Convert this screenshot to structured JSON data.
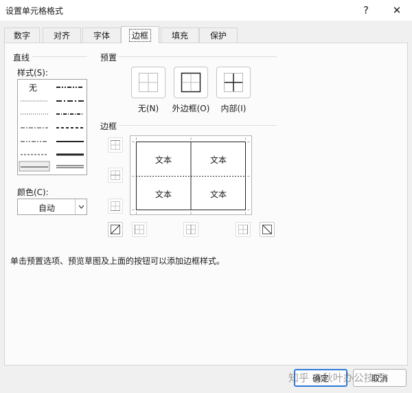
{
  "window": {
    "title": "设置单元格格式",
    "help_glyph": "?",
    "close_glyph": "✕"
  },
  "tabs": [
    {
      "label": "数字"
    },
    {
      "label": "对齐"
    },
    {
      "label": "字体"
    },
    {
      "label": "边框",
      "active": true
    },
    {
      "label": "填充"
    },
    {
      "label": "保护"
    }
  ],
  "line": {
    "group_label": "直线",
    "style_label": "样式(S):",
    "none_label": "无",
    "color_label": "颜色(C):",
    "color_value": "自动"
  },
  "presets": {
    "group_label": "预置",
    "none_label": "无(N)",
    "outline_label": "外边框(O)",
    "inside_label": "内部(I)"
  },
  "border": {
    "group_label": "边框",
    "preview_cells": [
      "文本",
      "文本",
      "文本",
      "文本"
    ]
  },
  "hint": "单击预置选项、预览草图及上面的按钮可以添加边框样式。",
  "footer": {
    "ok_label": "确定",
    "cancel_label": "取消"
  },
  "watermark": "知乎 @秋叶办公技巧",
  "colors": {
    "accent": "#2b79d8",
    "panel_bg": "#fbfbfb",
    "dialog_bg": "#f0f0f0"
  }
}
